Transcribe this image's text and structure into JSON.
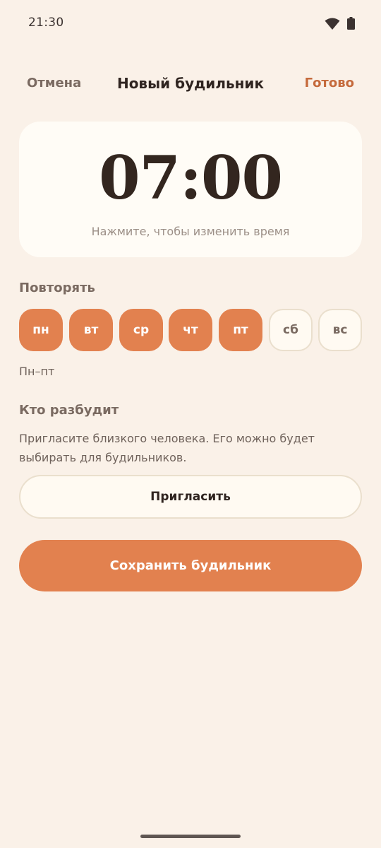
{
  "status_bar": {
    "time": "21:30",
    "icons": [
      "wifi-icon",
      "battery-icon"
    ]
  },
  "header": {
    "cancel_label": "Отмена",
    "title": "Новый будильник",
    "done_label": "Готово"
  },
  "alarm": {
    "time": "07:00",
    "hint": "Нажмите, чтобы изменить время"
  },
  "repeat": {
    "label": "Повторять",
    "days": [
      {
        "label": "пн",
        "selected": true
      },
      {
        "label": "вт",
        "selected": true
      },
      {
        "label": "ср",
        "selected": true
      },
      {
        "label": "чт",
        "selected": true
      },
      {
        "label": "пт",
        "selected": true
      },
      {
        "label": "сб",
        "selected": false
      },
      {
        "label": "вс",
        "selected": false
      }
    ],
    "summary": "Пн–пт"
  },
  "wake": {
    "label": "Кто разбудит",
    "description": "Пригласите близкого человека. Его можно будет выбирать для будильников.",
    "invite_label": "Пригласить"
  },
  "save_label": "Сохранить будильник",
  "colors": {
    "background": "#faf1e8",
    "accent": "#e2814f",
    "done_text": "#c56a3c",
    "card": "#fffcf6"
  }
}
